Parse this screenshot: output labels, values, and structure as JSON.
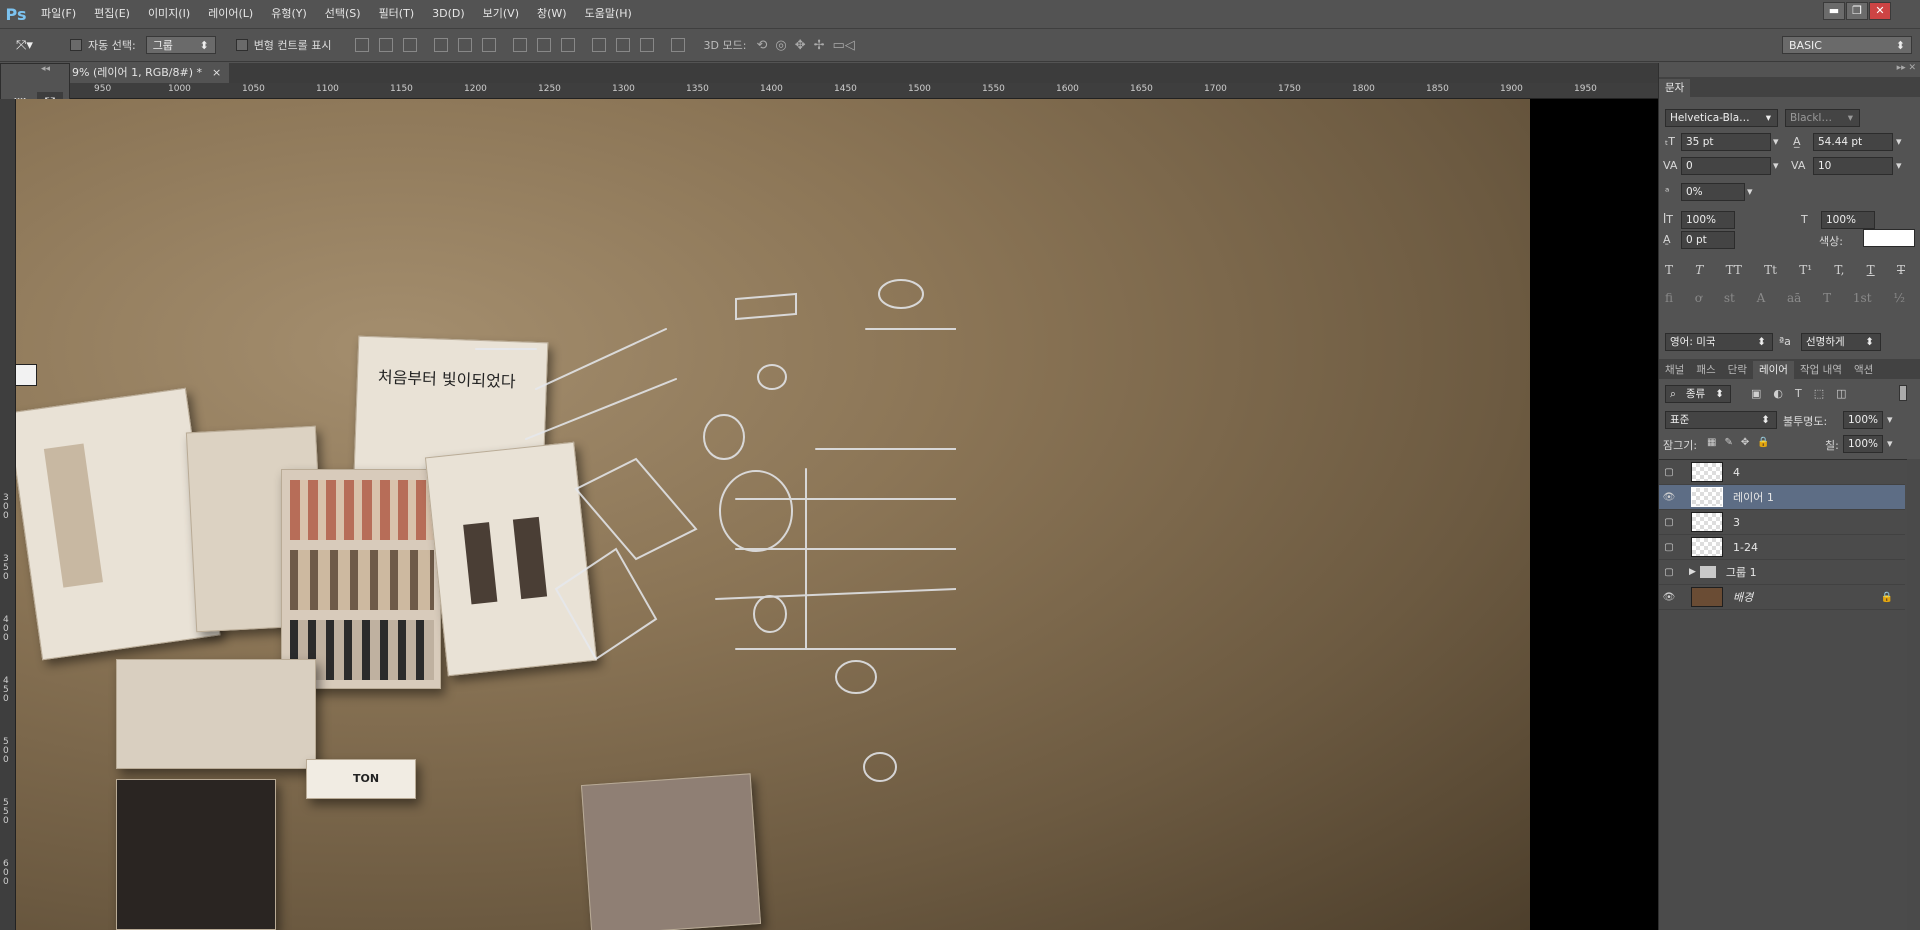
{
  "app": {
    "logo": "Ps"
  },
  "menu": [
    "파일(F)",
    "편집(E)",
    "이미지(I)",
    "레이어(L)",
    "유형(Y)",
    "선택(S)",
    "필터(T)",
    "3D(D)",
    "보기(V)",
    "창(W)",
    "도움말(H)"
  ],
  "window_controls": {
    "minimize": "▬",
    "restore": "❐",
    "close": "✕"
  },
  "options": {
    "auto_select_label": "자동 선택:",
    "auto_select_value": "그룹",
    "transform_label": "변형 컨트롤 표시",
    "mode_3d_label": "3D 모드:",
    "workspace": "BASIC"
  },
  "document": {
    "tab_title": "9% (레이어 1, RGB/8#) *",
    "close": "×"
  },
  "ruler": {
    "h_ticks": [
      "950",
      "1000",
      "1050",
      "1100",
      "1150",
      "1200",
      "1250",
      "1300",
      "1350",
      "1400",
      "1450",
      "1500",
      "1550",
      "1600",
      "1650",
      "1700",
      "1750",
      "1800",
      "1850",
      "1900",
      "1950"
    ],
    "v_ticks": [
      "300",
      "350",
      "400",
      "450",
      "500",
      "550",
      "600"
    ]
  },
  "character_panel": {
    "tab": "문자",
    "font_family": "Helvetica-Bla…",
    "font_style": "BlackI…",
    "font_size": "35 pt",
    "leading": "54.44 pt",
    "kerning": "0",
    "tracking": "10",
    "tsume": "0%",
    "vscale": "100%",
    "hscale": "100%",
    "baseline": "0 pt",
    "color_label": "색상:",
    "style_buttons": [
      "T",
      "T",
      "TT",
      "Tt",
      "T¹",
      "T,",
      "T",
      "T"
    ],
    "otf_buttons": [
      "fi",
      "ơ",
      "st",
      "A",
      "aā",
      "T",
      "1st",
      "½"
    ],
    "language": "영어: 미국",
    "aa_label": "ªa",
    "antialias": "선명하게"
  },
  "layers_panel": {
    "tabs": [
      "채널",
      "패스",
      "단락",
      "레이어",
      "작업 내역",
      "액션"
    ],
    "active_tab": "레이어",
    "filter_label": "종류",
    "blend_mode": "표준",
    "opacity_label": "불투명도:",
    "opacity": "100%",
    "lock_label": "잠그기:",
    "fill_label": "칠:",
    "fill": "100%",
    "layers": [
      {
        "name": "4",
        "visible": false
      },
      {
        "name": "레이어 1",
        "visible": true,
        "selected": true
      },
      {
        "name": "3",
        "visible": false
      },
      {
        "name": "1-24",
        "visible": false
      },
      {
        "name": "그룹 1",
        "visible": false,
        "group": true
      },
      {
        "name": "배경",
        "visible": true,
        "locked": true
      }
    ]
  },
  "canvas_text": {
    "brand_sign": "TON",
    "pinned_note": "처음부터 빛이되었다"
  }
}
